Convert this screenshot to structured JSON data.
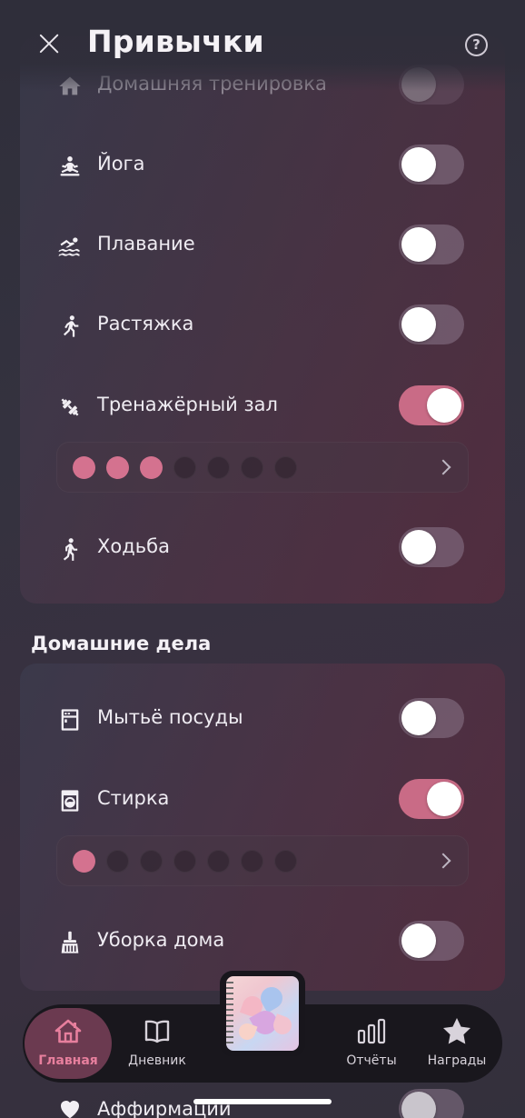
{
  "header": {
    "title": "Привычки",
    "help_glyph": "?"
  },
  "fitness": {
    "habits": [
      {
        "label": "Домашняя тренировка",
        "icon": "home-icon",
        "on": false
      },
      {
        "label": "Йога",
        "icon": "yoga-icon",
        "on": false
      },
      {
        "label": "Плавание",
        "icon": "swimming-icon",
        "on": false
      },
      {
        "label": "Растяжка",
        "icon": "stretching-icon",
        "on": false
      },
      {
        "label": "Тренажёрный зал",
        "icon": "dumbbell-icon",
        "on": true,
        "progress": {
          "done": 3,
          "total": 7
        }
      },
      {
        "label": "Ходьба",
        "icon": "walking-icon",
        "on": false
      }
    ]
  },
  "home_chores": {
    "title": "Домашние дела",
    "habits": [
      {
        "label": "Мытьё посуды",
        "icon": "dishwasher-icon",
        "on": false
      },
      {
        "label": "Стирка",
        "icon": "washing-machine-icon",
        "on": true,
        "progress": {
          "done": 1,
          "total": 7
        }
      },
      {
        "label": "Уборка дома",
        "icon": "broom-icon",
        "on": false
      }
    ]
  },
  "partial": {
    "label": "Аффирмации",
    "icon": "heart-icon",
    "on": false
  },
  "nav": {
    "home": "Главная",
    "diary": "Дневник",
    "reports": "Отчёты",
    "awards": "Награды"
  },
  "colors": {
    "accent": "#d4728f",
    "toggle_on": "#c96b86",
    "nav_active": "#e77f9d"
  }
}
